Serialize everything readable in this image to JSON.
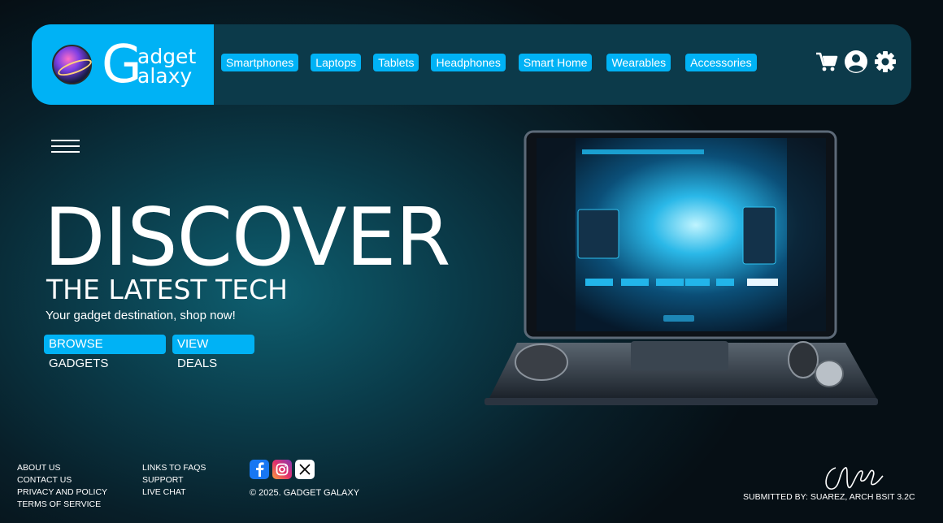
{
  "brand": {
    "big_letter_top": "G",
    "big_letter_bottom": "G",
    "word_top": "adget",
    "word_bottom": "alaxy",
    "accent_color": "#00b2f5"
  },
  "nav": {
    "items": [
      {
        "label": "Smartphones"
      },
      {
        "label": "Laptops"
      },
      {
        "label": "Tablets"
      },
      {
        "label": "Headphones"
      },
      {
        "label": "Smart Home"
      },
      {
        "label": "Wearables"
      },
      {
        "label": "Accessories"
      }
    ],
    "icons": [
      "cart-icon",
      "user-icon",
      "gear-icon"
    ]
  },
  "hero": {
    "headline": "DISCOVER",
    "subheadline": "THE LATEST TECH",
    "tagline": "Your gadget destination, shop now!",
    "browse_label": "BROWSE GADGETS",
    "deals_label": "VIEW DEALS"
  },
  "footer": {
    "col1": [
      "ABOUT US",
      "CONTACT US",
      "PRIVACY AND POLICY",
      "TERMS OF SERVICE"
    ],
    "col2": [
      "LINKS TO FAQS",
      "SUPPORT",
      "LIVE CHAT"
    ],
    "socials": [
      "facebook-icon",
      "instagram-icon",
      "x-icon"
    ],
    "copyright": "© 2025. GADGET GALAXY",
    "submitted": "SUBMITTED BY: SUAREZ, ARCH BSIT 3.2C"
  }
}
